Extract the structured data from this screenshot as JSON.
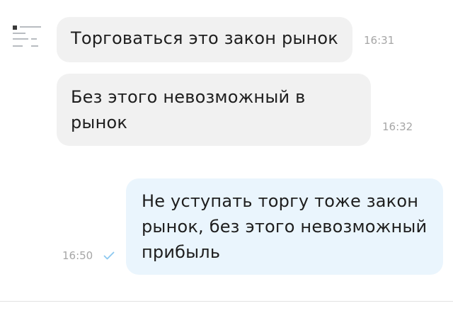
{
  "chat": {
    "messages": [
      {
        "direction": "incoming",
        "text": "Торговаться это закон рынок",
        "time": "16:31"
      },
      {
        "direction": "incoming",
        "text": "Без этого невозможный в рынок",
        "time": "16:32"
      },
      {
        "direction": "outgoing",
        "text": "Не уступать торгу тоже закон рынок, без этого невозможный прибыль",
        "time": "16:50",
        "status_icon": "single-check-icon"
      }
    ]
  },
  "colors": {
    "incoming_bubble": "#f1f1f1",
    "outgoing_bubble": "#eaf5fd",
    "timestamp": "#a6a6a6",
    "check": "#8cc8f0"
  }
}
